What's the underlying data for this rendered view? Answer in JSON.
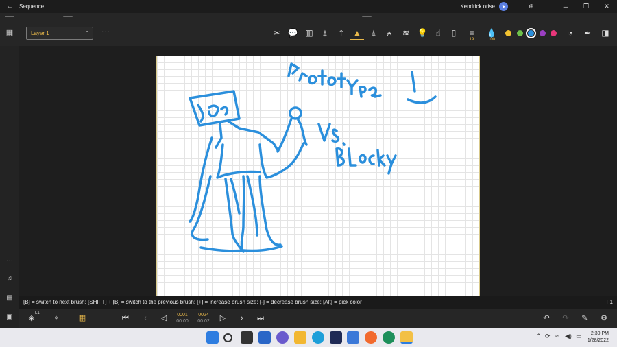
{
  "titlebar": {
    "title": "Sequence",
    "user": "Kendrick orise"
  },
  "toolbar": {
    "layer": "Layer 1",
    "brush_size": "19",
    "opacity": "100",
    "colors": [
      "#f2c230",
      "#6ec04a",
      "#2b8fdc",
      "#9b3fc2",
      "#e8367a"
    ],
    "selected_color_index": 2
  },
  "canvas": {
    "stroke_color": "#2b8fdc"
  },
  "hint": {
    "text": "[B] = switch to next brush; [SHIFT] + [B] = switch to the previous brush; [+] = increase brush size; [-] = decrease brush size; [Alt] = pick color",
    "key": "F1"
  },
  "timeline": {
    "layer_label": "L1",
    "current_frame": "0001",
    "current_time": "00:00",
    "total_frames": "0024",
    "total_time": "00:02"
  },
  "taskbar": {
    "time": "2:30 PM",
    "date": "1/28/2022"
  }
}
